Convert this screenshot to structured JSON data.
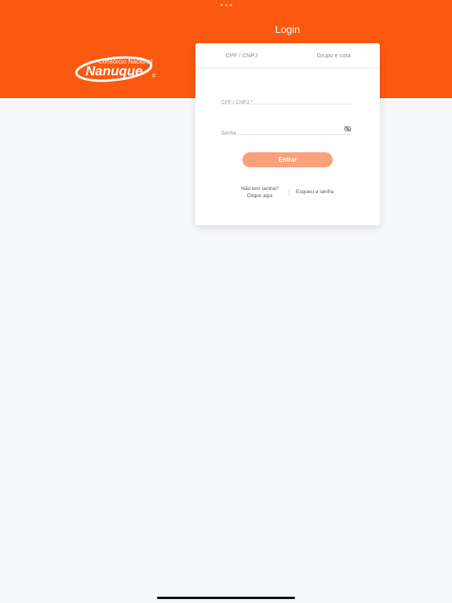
{
  "header": {
    "title": "Login",
    "brand_top": "Consórcio Nacional",
    "brand_main": "Nanuque"
  },
  "colors": {
    "brand": "#fb5810",
    "button": "#fba07a",
    "background": "#f7f8fb"
  },
  "tabs": [
    {
      "label": "CPF / CNPJ"
    },
    {
      "label": "Grupo e cota"
    }
  ],
  "form": {
    "cpf_placeholder": "CPF / CNPJ *",
    "senha_placeholder": "Senha",
    "submit_label": "Entrar"
  },
  "links": {
    "no_password_line1": "Não tem senha?",
    "no_password_line2": "Clique aqui",
    "forgot_password": "Esqueci a senha"
  },
  "icons": {
    "password_toggle": "eye-off-icon"
  }
}
